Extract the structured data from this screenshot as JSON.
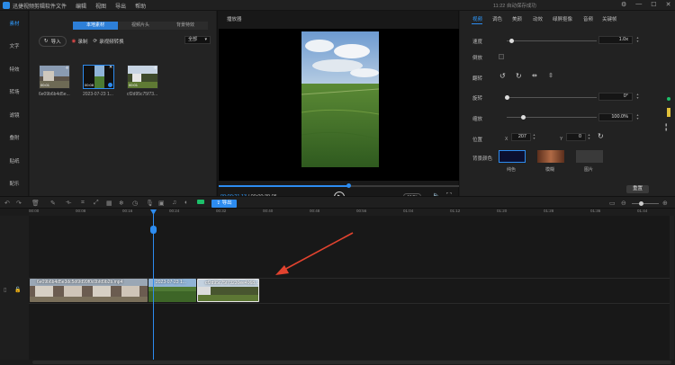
{
  "app": {
    "title": "迅捷视频剪辑软件",
    "menu": [
      "文件",
      "编辑",
      "视图",
      "导出",
      "帮助"
    ],
    "save_status": "11:22 自动保存成功"
  },
  "sidebar": {
    "items": [
      {
        "label": "素材",
        "active": true
      },
      {
        "label": "文字",
        "active": false
      },
      {
        "label": "特效",
        "active": false
      },
      {
        "label": "转场",
        "active": false
      },
      {
        "label": "滤镜",
        "active": false
      },
      {
        "label": "叠附",
        "active": false
      },
      {
        "label": "贴纸",
        "active": false
      },
      {
        "label": "配乐",
        "active": false
      }
    ]
  },
  "library": {
    "tabs": [
      {
        "label": "本地素材",
        "active": true
      },
      {
        "label": "视频片头",
        "active": false
      },
      {
        "label": "背景特效",
        "active": false
      }
    ],
    "import_label": "导入",
    "record_label": "录制",
    "screen_record_label": "录视频转换",
    "filter_value": "全部",
    "thumbnails": [
      {
        "label": "6e09b6b4d5e...",
        "duration": "00:01",
        "selected": false
      },
      {
        "label": "2023-07-23 1...",
        "duration": "00:08",
        "selected": true
      },
      {
        "label": "cf2d95c75f73...",
        "duration": "00:01",
        "selected": false
      }
    ]
  },
  "player": {
    "title": "播放器",
    "current_time": "00:00:21.13",
    "total_time": "00:00:39.05",
    "progress": 0.54,
    "aspect_ratio": "16:9"
  },
  "properties": {
    "tabs": [
      {
        "label": "视频",
        "active": true
      },
      {
        "label": "调色",
        "active": false
      },
      {
        "label": "美颜",
        "active": false
      },
      {
        "label": "动效",
        "active": false
      },
      {
        "label": "绿屏抠像",
        "active": false
      },
      {
        "label": "音频",
        "active": false
      },
      {
        "label": "关键帧",
        "active": false
      }
    ],
    "speed_label": "速度",
    "speed_value": "1.0x",
    "speed_position": 0.05,
    "reverse_label": "倒放",
    "flip_label": "翻转",
    "rotate_label": "旋转",
    "rotate_value": "0°",
    "rotate_position": 0.0,
    "scale_label": "缩放",
    "scale_value": "100.0%",
    "scale_position": 0.18,
    "position_label": "位置",
    "pos_x_label": "X",
    "pos_x": "207",
    "pos_y_label": "Y",
    "pos_y": "0",
    "bg_color_label": "背景颜色",
    "bg_options": [
      "纯色",
      "模糊",
      "图片"
    ],
    "reset_label": "重置"
  },
  "timeline": {
    "export_label": "导出",
    "ruler_ticks": [
      "00:00",
      "00:08",
      "00:16",
      "00:24",
      "00:32",
      "00:40",
      "00:48",
      "00:56",
      "01:04",
      "01:12",
      "01:20",
      "01:28",
      "01:36",
      "01:44"
    ],
    "clips": [
      {
        "name": "6e09b6b4d5e3dc5d6fd99f0c0bfd9b2b.mp4"
      },
      {
        "name": "2023-07-23 1..."
      },
      {
        "name": "cf2d95c75f73230ee4068..."
      }
    ]
  },
  "colors": {
    "accent": "#2d8cf0",
    "annotation_arrow": "#e2432f"
  }
}
